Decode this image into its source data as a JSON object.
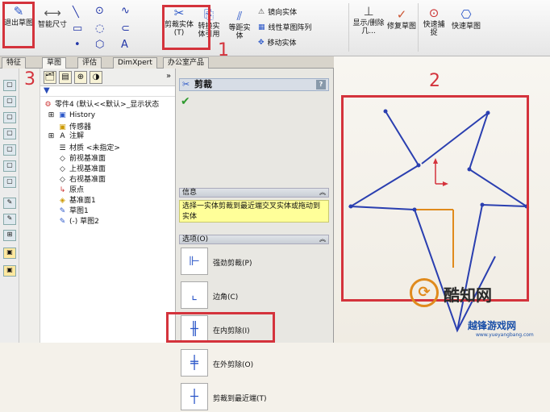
{
  "ribbon": {
    "exit_sketch": "退出草图",
    "smart_dimension": "智能尺寸",
    "trim": "剪裁实体(T)",
    "convert": "转换实体引用",
    "offset": "等距实体",
    "mirror": "镜向实体",
    "linear_pattern": "线性草图阵列",
    "move": "移动实体",
    "show_delete": "显示/删除几...",
    "repair_sketch": "修复草图",
    "quick_snap": "快速捕捉",
    "rapid_sketch": "快速草图"
  },
  "tabs": [
    "特征",
    "草图",
    "评估",
    "DimXpert",
    "办公室产品"
  ],
  "tree": {
    "filter_icon": "filter-icon",
    "part": "零件4 (默认<<默认>_显示状态",
    "items": [
      "History",
      "传感器",
      "注解",
      "材质 <未指定>",
      "前视基准面",
      "上视基准面",
      "右视基准面",
      "原点",
      "基准面1",
      "草图1",
      "(-) 草图2"
    ]
  },
  "pm": {
    "title": "剪裁",
    "help": "?",
    "info_header": "信息",
    "info_message": "选择一实体剪裁到最近端交叉实体或拖动到实体",
    "options_header": "选项(O)",
    "options": [
      "强劲剪裁(P)",
      "边角(C)",
      "在内剪除(I)",
      "在外剪除(O)",
      "剪裁到最近端(T)"
    ]
  },
  "annotations": [
    "1",
    "2",
    "3"
  ],
  "watermark": {
    "text1": "酷知网",
    "text2": "越锋游戏网",
    "url": "www.yueyangbang.com"
  },
  "colors": {
    "accent_red": "#d4333c",
    "sketch_blue": "#2a3fb0",
    "sketch_orange": "#e08a1c"
  }
}
